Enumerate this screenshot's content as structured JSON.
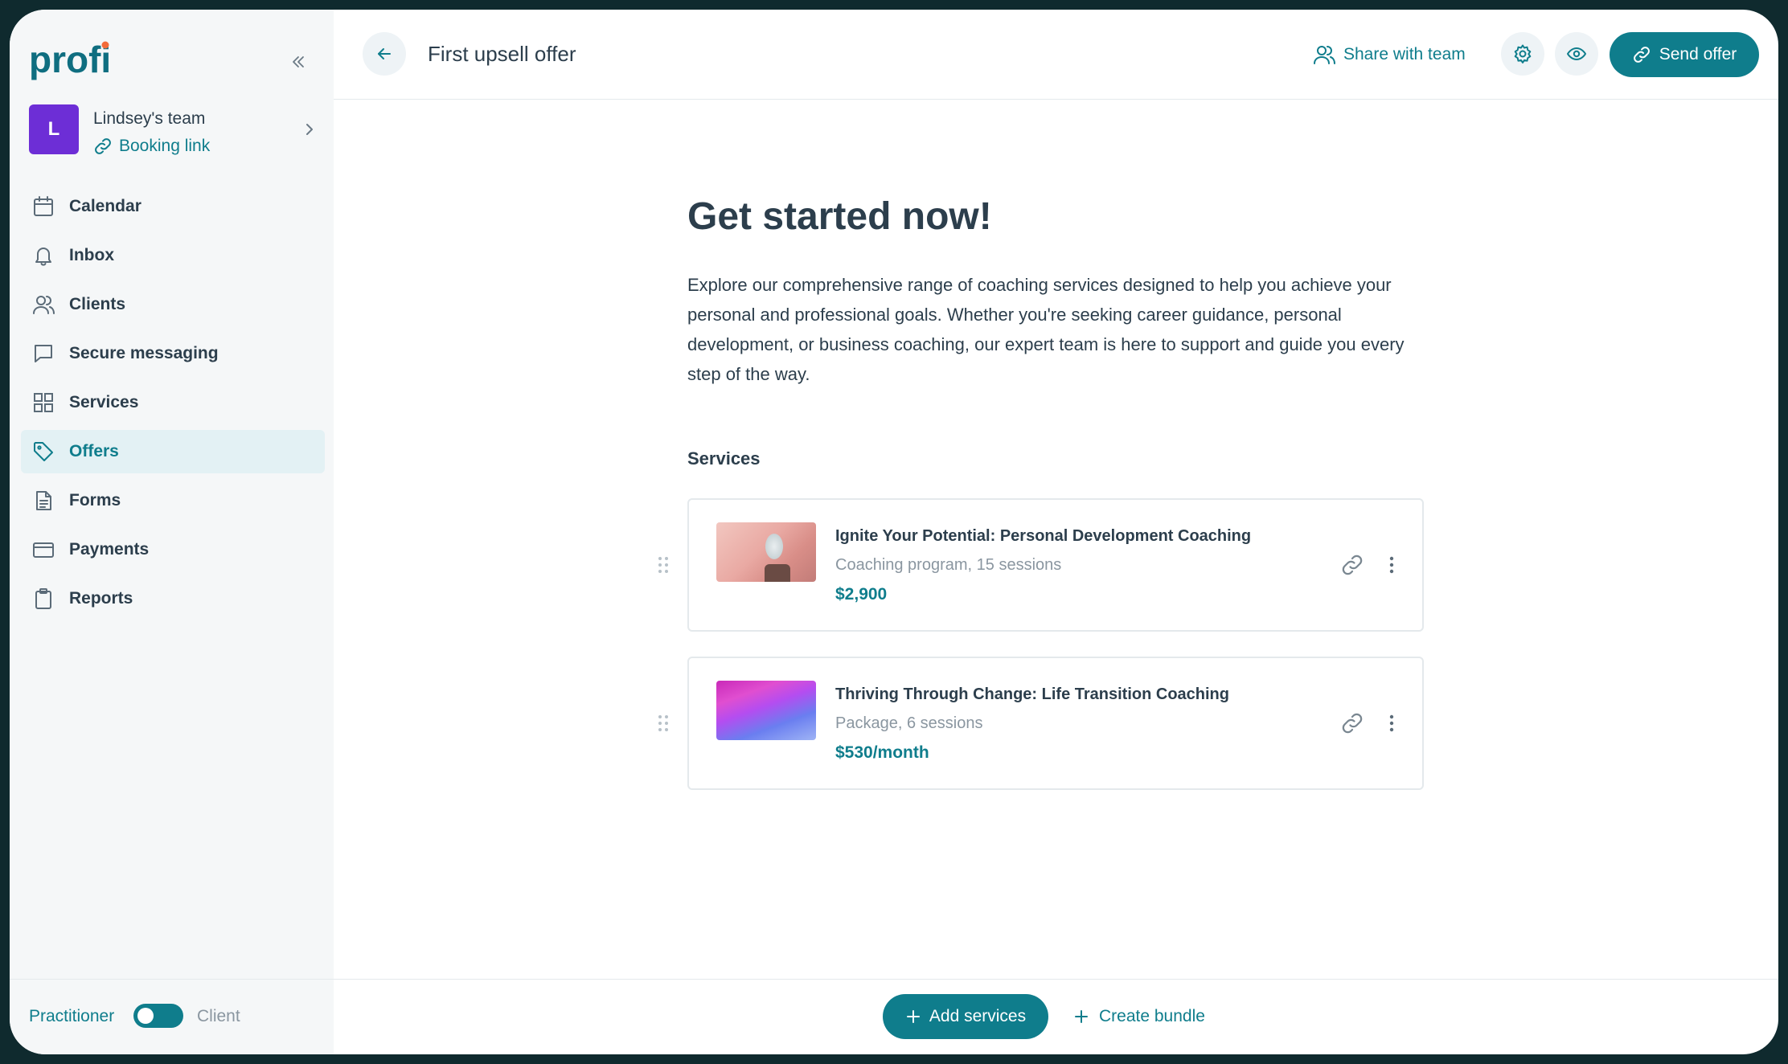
{
  "app": {
    "logo_text": "profi",
    "accent_color": "#0f7d8c",
    "logo_dot_color": "#f26b3a"
  },
  "sidebar": {
    "team": {
      "avatar_letter": "L",
      "name": "Lindsey's team",
      "booking_link": "Booking link"
    },
    "items": [
      {
        "label": "Calendar",
        "icon": "calendar-icon"
      },
      {
        "label": "Inbox",
        "icon": "bell-icon"
      },
      {
        "label": "Clients",
        "icon": "users-icon"
      },
      {
        "label": "Secure messaging",
        "icon": "message-icon"
      },
      {
        "label": "Services",
        "icon": "grid-icon"
      },
      {
        "label": "Offers",
        "icon": "tag-icon",
        "active": true
      },
      {
        "label": "Forms",
        "icon": "document-icon"
      },
      {
        "label": "Payments",
        "icon": "credit-card-icon"
      },
      {
        "label": "Reports",
        "icon": "clipboard-icon"
      }
    ],
    "mode": {
      "left": "Practitioner",
      "right": "Client"
    }
  },
  "header": {
    "title": "First upsell offer",
    "share_label": "Share with team",
    "send_label": "Send offer"
  },
  "main": {
    "heading": "Get started now!",
    "intro": "Explore our comprehensive range of coaching services designed to help you achieve your personal and professional goals. Whether you're seeking career guidance, personal development, or business coaching, our expert team is here to support and guide you every step of the way.",
    "services_label": "Services",
    "services": [
      {
        "title": "Ignite Your Potential: Personal Development Coaching",
        "subtitle": "Coaching program, 15 sessions",
        "price": "$2,900"
      },
      {
        "title": "Thriving Through Change: Life Transition Coaching",
        "subtitle": "Package, 6 sessions",
        "price": "$530/month"
      }
    ]
  },
  "footer": {
    "add_services_label": "Add services",
    "create_bundle_label": "Create bundle"
  }
}
